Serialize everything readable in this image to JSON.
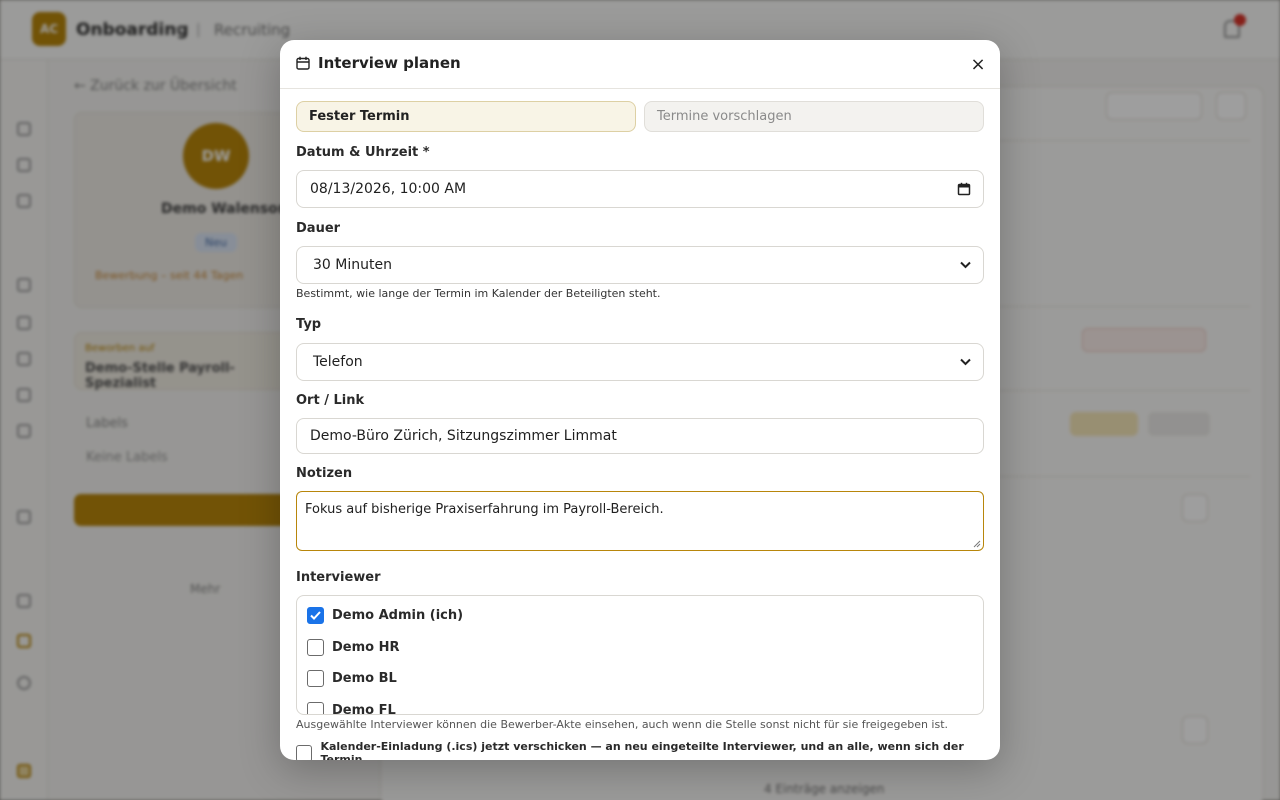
{
  "background": {
    "logo_text": "AC",
    "brand": "Onboarding",
    "nav_recruiting": "Recruiting",
    "back_link": "← Zurück zur Übersicht",
    "avatar_initials": "DW",
    "candidate_name": "Demo Walenson",
    "status_badge": "Neu",
    "warning_text": "Bewerbung – seit 44 Tagen",
    "applied_for_label": "Beworben auf",
    "applied_for_title": "Demo-Stelle Payroll-Spezialist",
    "labels_heading": "Labels",
    "labels_empty": "Keine Labels",
    "more_link": "Mehr",
    "bottom_text": "4 Einträge anzeigen"
  },
  "modal": {
    "title": "Interview planen",
    "close_label": "×",
    "mode_tabs": [
      {
        "label": "Fester Termin",
        "active": true
      },
      {
        "label": "Termine vorschlagen",
        "active": false
      }
    ],
    "datetime_label": "Datum & Uhrzeit *",
    "datetime_value": "08/13/2026, 10:00 AM",
    "duration_label": "Dauer",
    "duration_value": "30 Minuten",
    "duration_help": "Bestimmt, wie lange der Termin im Kalender der Beteiligten steht.",
    "type_label": "Typ",
    "type_value": "Telefon",
    "location_label": "Ort / Link",
    "location_value": "Demo-Büro Zürich, Sitzungszimmer Limmat",
    "notes_label": "Notizen",
    "notes_value": "Fokus auf bisherige Praxiserfahrung im Payroll-Bereich.",
    "interviewers_label": "Interviewer",
    "interviewers": [
      {
        "name": "Demo Admin (ich)",
        "checked": true
      },
      {
        "name": "Demo HR",
        "checked": false
      },
      {
        "name": "Demo BL",
        "checked": false
      },
      {
        "name": "Demo FL",
        "checked": false
      }
    ],
    "interviewers_help": "Ausgewählte Interviewer können die Bewerber-Akte einsehen, auch wenn die Stelle sonst nicht für sie freigegeben ist.",
    "ics_label": "Kalender-Einladung (.ics) jetzt verschicken — an neu eingeteilte Interviewer, und an alle, wenn sich der Termin",
    "ics_checked": false
  },
  "colors": {
    "accent": "#b8860b",
    "checkbox_on": "#1a73e8"
  }
}
